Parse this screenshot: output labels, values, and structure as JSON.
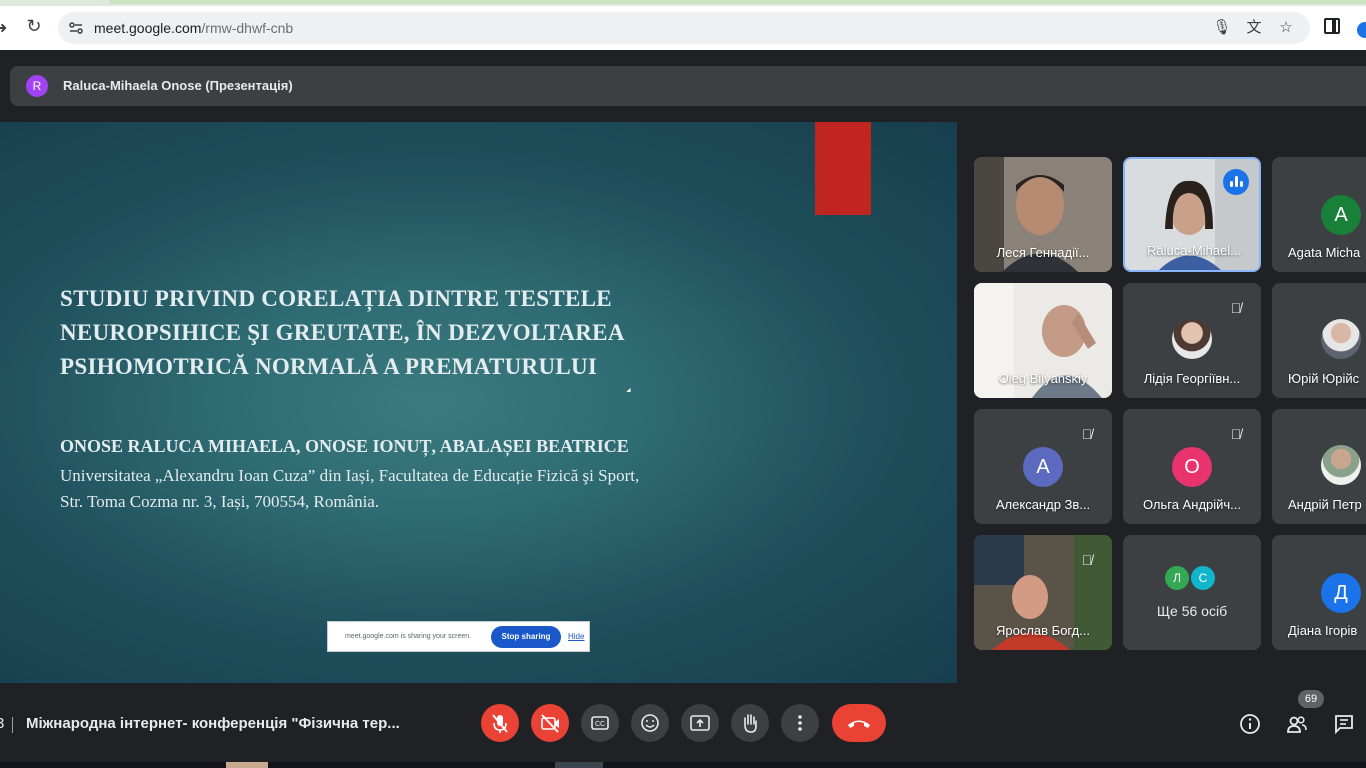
{
  "browser": {
    "url_host": "meet.google.com",
    "url_path": "/rmw-dhwf-cnb"
  },
  "presenter": {
    "initial": "R",
    "label": "Raluca-Mihaela Onose (Презентація)"
  },
  "slide": {
    "title_lines": [
      "STUDIU PRIVIND CORELAȚIA DINTRE TESTELE",
      "NEUROPSIHICE ŞI GREUTATE,  ÎN DEZVOLTAREA",
      "PSIHOMOTRICĂ NORMALĂ A PREMATURULUI"
    ],
    "authors": "ONOSE RALUCA MIHAELA, ONOSE IONUȚ, ABALAȘEI BEATRICE",
    "affiliation_lines": [
      "Universitatea „Alexandru Ioan Cuza” din Iași, Facultatea de Educație Fizică şi Sport,",
      "Str. Toma Cozma nr. 3, Iași, 700554, România."
    ]
  },
  "share_notice": {
    "text": "meet.google.com is sharing your screen.",
    "stop": "Stop sharing",
    "hide": "Hide"
  },
  "participants": [
    {
      "name": "Леся Геннадії..."
    },
    {
      "name": "Raluca-Mihael..."
    },
    {
      "name": "Agata Micha",
      "initial": "A",
      "color": "#188038"
    },
    {
      "name": "Oleg Bilyanskiy"
    },
    {
      "name": "Лідія Георгіївн..."
    },
    {
      "name": "Юрій Юрійс"
    },
    {
      "name": "Александр Зв...",
      "initial": "A",
      "color": "#5c6bc0"
    },
    {
      "name": "Ольга Андрійч...",
      "initial": "О",
      "color": "#e8336f"
    },
    {
      "name": "Андрій Петр"
    },
    {
      "name": "Ярослав Богд..."
    },
    {
      "name": "Діана Ігорів",
      "initial": "Д",
      "color": "#1a73e8"
    }
  ],
  "more": {
    "initials": [
      "Л",
      "С"
    ],
    "colors": [
      "#34a853",
      "#12b5cb"
    ],
    "label": "Ще 56 осіб"
  },
  "bottom": {
    "time_fragment": "3",
    "meeting_title": "Міжнародна інтернет- конференція \"Фізична тер...",
    "participant_count": "69"
  }
}
